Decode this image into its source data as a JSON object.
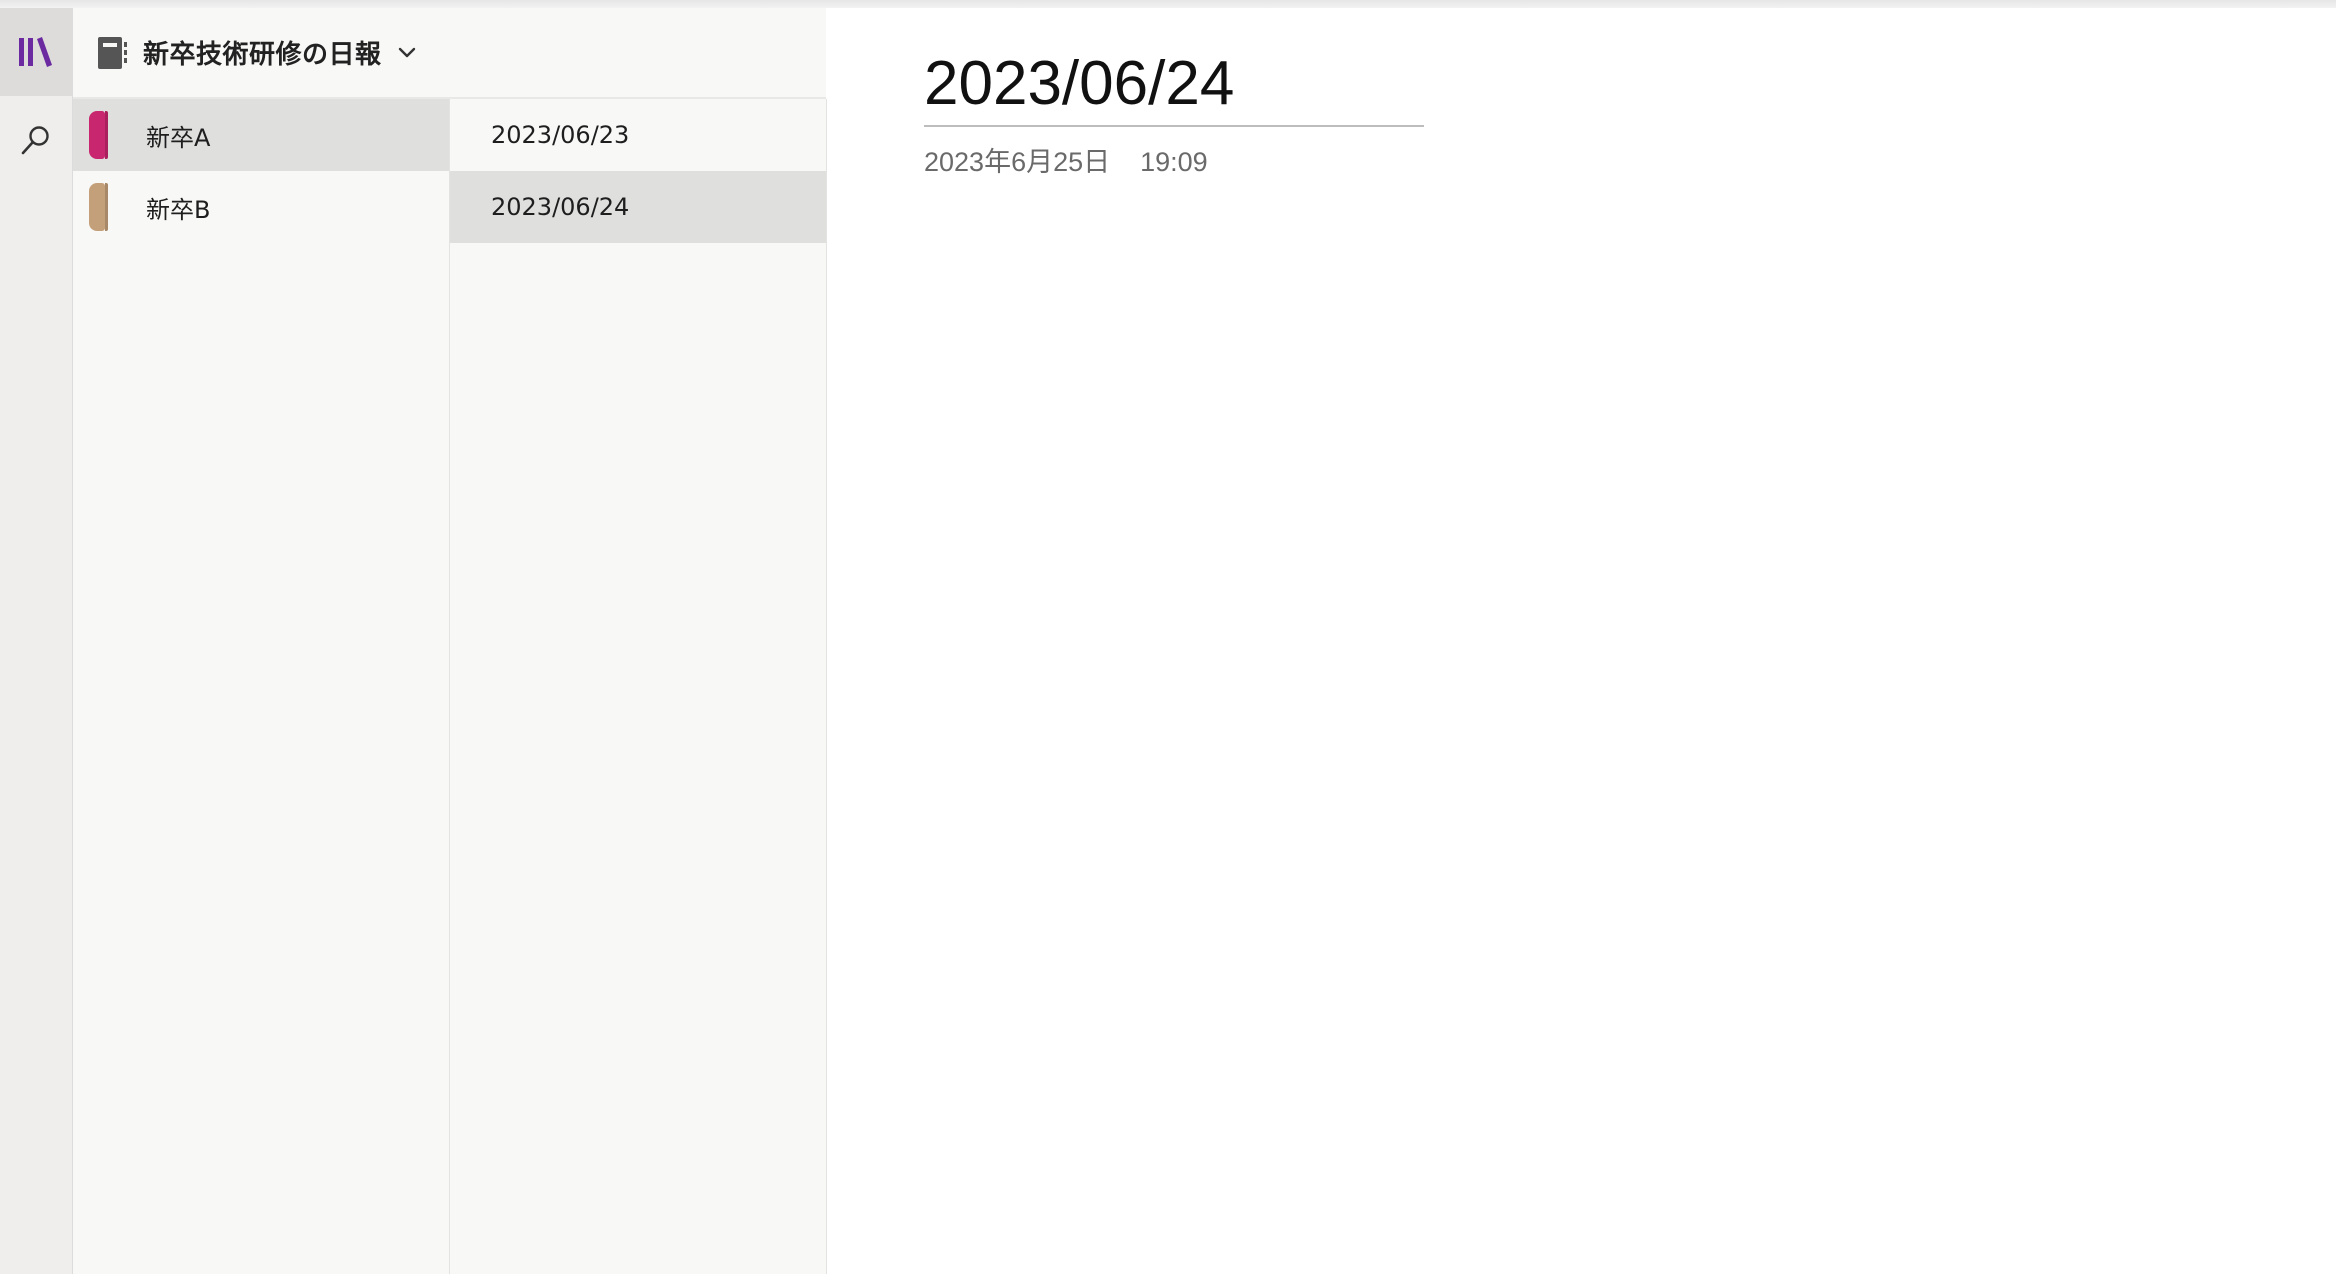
{
  "notebook": {
    "title": "新卒技術研修の日報",
    "icon": "notebook-icon",
    "dropdown_icon": "chevron-down-icon"
  },
  "rail": {
    "items": [
      {
        "name": "notebooks-icon",
        "color": "#7a2a9a"
      },
      {
        "name": "search-icon",
        "color": "#333333"
      }
    ]
  },
  "sections": [
    {
      "label": "新卒A",
      "color": "#c8266e",
      "selected": true
    },
    {
      "label": "新卒B",
      "color": "#c4a07a",
      "selected": false
    }
  ],
  "pages": [
    {
      "label": "2023/06/23",
      "selected": false
    },
    {
      "label": "2023/06/24",
      "selected": true
    }
  ],
  "page": {
    "title": "2023/06/24",
    "date": "2023年6月25日",
    "time": "19:09"
  }
}
